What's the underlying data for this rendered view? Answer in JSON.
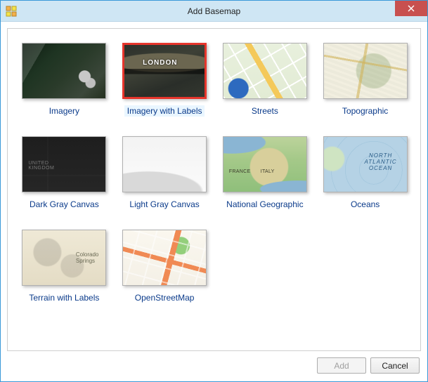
{
  "window": {
    "title": "Add Basemap"
  },
  "basemaps": [
    {
      "label": "Imagery",
      "thumbClass": "th-imagery",
      "selected": false
    },
    {
      "label": "Imagery with Labels",
      "thumbClass": "th-imagery-labels",
      "selected": true
    },
    {
      "label": "Streets",
      "thumbClass": "th-streets",
      "selected": false
    },
    {
      "label": "Topographic",
      "thumbClass": "th-topo",
      "selected": false
    },
    {
      "label": "Dark Gray Canvas",
      "thumbClass": "th-darkgray",
      "selected": false
    },
    {
      "label": "Light Gray Canvas",
      "thumbClass": "th-lightgray",
      "selected": false
    },
    {
      "label": "National Geographic",
      "thumbClass": "th-natgeo",
      "selected": false
    },
    {
      "label": "Oceans",
      "thumbClass": "th-oceans",
      "selected": false
    },
    {
      "label": "Terrain with Labels",
      "thumbClass": "th-terrain",
      "selected": false
    },
    {
      "label": "OpenStreetMap",
      "thumbClass": "th-osm",
      "selected": false
    }
  ],
  "buttons": {
    "add": {
      "label": "Add",
      "enabled": false
    },
    "cancel": {
      "label": "Cancel",
      "enabled": true
    }
  },
  "colors": {
    "titlebar_bg": "#cfe6f4",
    "window_border": "#3a99d8",
    "close_bg": "#c8504f",
    "link_text": "#0a3a8a",
    "selection_outline": "#e6352c",
    "selection_bg": "#eaf6ff"
  }
}
